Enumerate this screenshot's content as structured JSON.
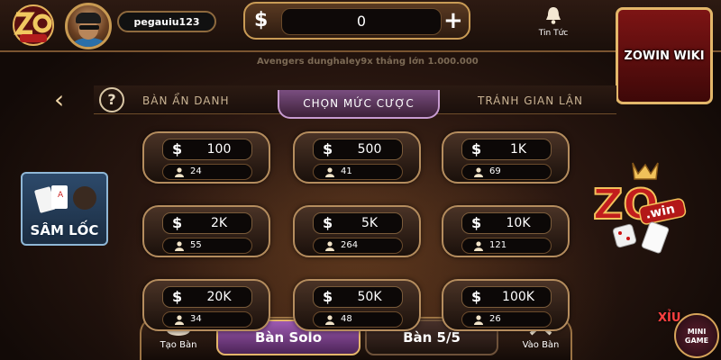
{
  "header": {
    "username": "pegauiu123",
    "coins": "0",
    "coin_symbol": "$",
    "plus": "+",
    "news_label": "Tin Tức",
    "ticker": "Avengers dunghaley9x thắng lớn 1.000.000"
  },
  "ad": {
    "label": "ZOWIN WIKI"
  },
  "nav": {
    "back_glyph": "‹",
    "help_glyph": "?"
  },
  "tabs": [
    {
      "label": "BÀN ẨN DANH"
    },
    {
      "label": "CHỌN MỨC CƯỢC"
    },
    {
      "label": "TRÁNH GIAN LẬN"
    }
  ],
  "bets": [
    {
      "amount": "100",
      "players": "24"
    },
    {
      "amount": "500",
      "players": "41"
    },
    {
      "amount": "1K",
      "players": "69"
    },
    {
      "amount": "2K",
      "players": "55"
    },
    {
      "amount": "5K",
      "players": "264"
    },
    {
      "amount": "10K",
      "players": "121"
    },
    {
      "amount": "20K",
      "players": "34"
    },
    {
      "amount": "50K",
      "players": "48"
    },
    {
      "amount": "100K",
      "players": "26"
    }
  ],
  "side": {
    "samloc_label": "SÂM LỐC"
  },
  "bottom": {
    "create_label": "Tạo Bàn",
    "solo_label": "Bàn Solo",
    "five_label": "Bàn 5/5",
    "join_label": "Vào Bàn",
    "xiu": "XỈU",
    "minigame_label": "MINI GAME"
  },
  "colors": {
    "gold": "#c99b55",
    "purple_active": "#7a4e80",
    "accent_red": "#7d1414"
  }
}
